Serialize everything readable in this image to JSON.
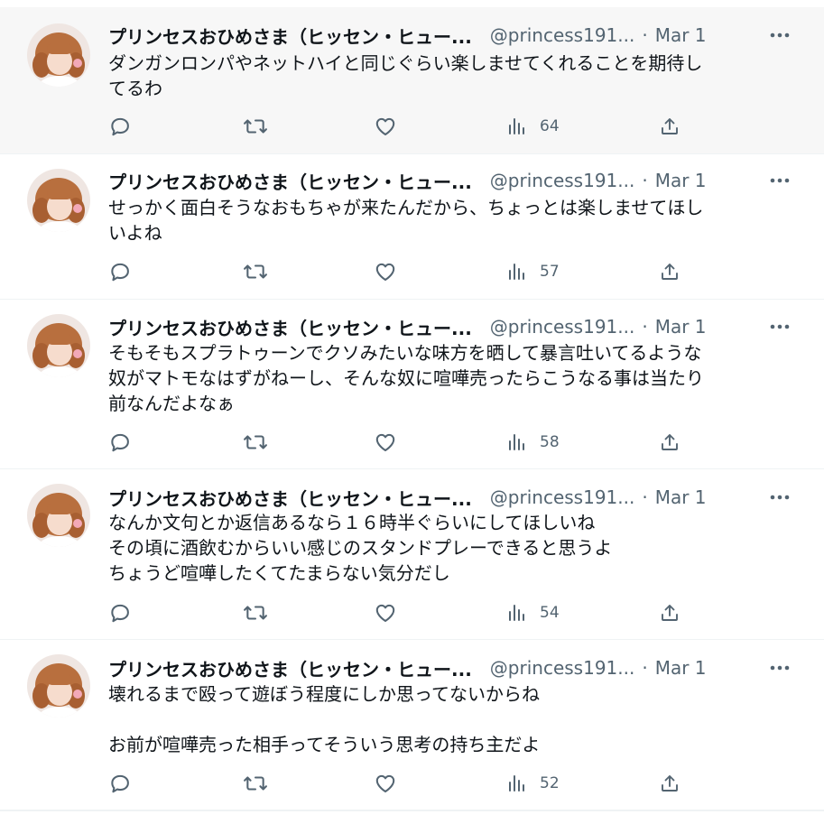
{
  "colors": {
    "text_primary": "#0f1419",
    "text_secondary": "#536471",
    "divider": "#eff3f4",
    "hover_background": "#f7f7f7"
  },
  "icons": {
    "reply": "reply-icon",
    "retweet": "retweet-icon",
    "like": "like-icon",
    "views": "views-icon",
    "share": "share-icon",
    "more": "more-icon"
  },
  "tweets": [
    {
      "display_name": "プリンセスおひめさま（ヒッセン・ヒュー...",
      "handle": "@princess191...",
      "separator": "·",
      "date": "Mar 1",
      "text": "ダンガンロンパやネットハイと同じぐらい楽しませてくれることを期待し\nてるわ",
      "views": "64"
    },
    {
      "display_name": "プリンセスおひめさま（ヒッセン・ヒュー...",
      "handle": "@princess191...",
      "separator": "·",
      "date": "Mar 1",
      "text": "せっかく面白そうなおもちゃが来たんだから、ちょっとは楽しませてほし\nいよね",
      "views": "57"
    },
    {
      "display_name": "プリンセスおひめさま（ヒッセン・ヒュー...",
      "handle": "@princess191...",
      "separator": "·",
      "date": "Mar 1",
      "text": "そもそもスプラトゥーンでクソみたいな味方を晒して暴言吐いてるような\n奴がマトモなはずがねーし、そんな奴に喧嘩売ったらこうなる事は当たり\n前なんだよなぁ",
      "views": "58"
    },
    {
      "display_name": "プリンセスおひめさま（ヒッセン・ヒュー...",
      "handle": "@princess191...",
      "separator": "·",
      "date": "Mar 1",
      "text": "なんか文句とか返信あるなら１６時半ぐらいにしてほしいね\nその頃に酒飲むからいい感じのスタンドプレーできると思うよ\nちょうど喧嘩したくてたまらない気分だし",
      "views": "54"
    },
    {
      "display_name": "プリンセスおひめさま（ヒッセン・ヒュー...",
      "handle": "@princess191...",
      "separator": "·",
      "date": "Mar 1",
      "text": "壊れるまで殴って遊ぼう程度にしか思ってないからね\n\nお前が喧嘩売った相手ってそういう思考の持ち主だよ",
      "views": "52"
    }
  ]
}
